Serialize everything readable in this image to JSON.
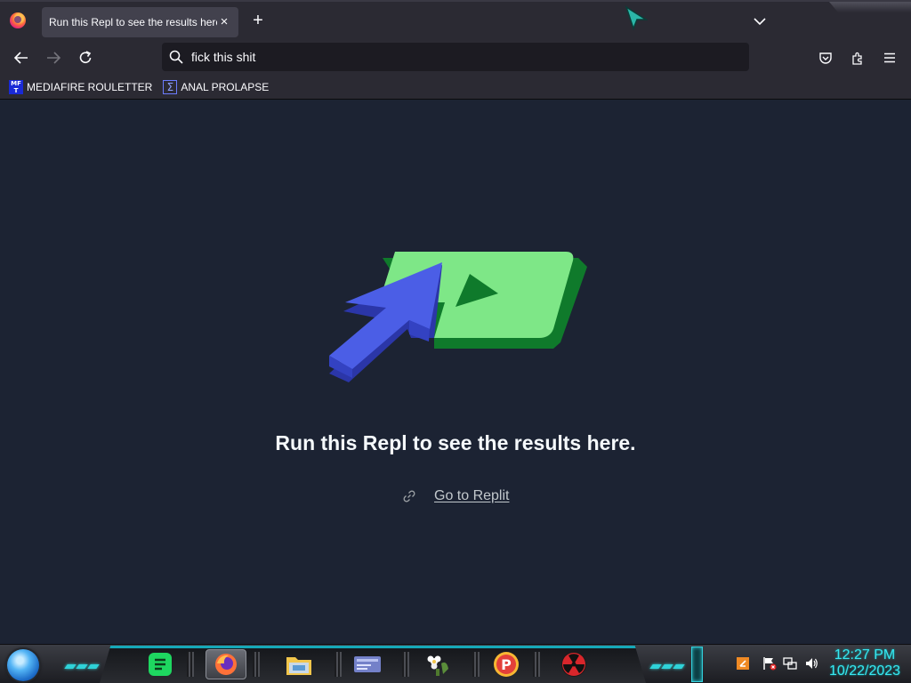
{
  "browser": {
    "tab": {
      "title": "Run this Repl to see the results here.",
      "close_glyph": "×"
    },
    "new_tab_glyph": "+",
    "url": {
      "value": "fick this shit"
    },
    "bookmarks": [
      {
        "label": "MEDIAFIRE ROULETTER",
        "favicon_text": "MF\nT",
        "icon": "mediafire-icon"
      },
      {
        "label": "ANAL PROLAPSE",
        "favicon_text": "Σ",
        "icon": "sigma-icon"
      }
    ]
  },
  "page": {
    "headline": "Run this Repl to see the results here.",
    "link_label": "Go to Replit",
    "colors": {
      "background": "#1c2333",
      "play_green": "#7ee787",
      "play_dark": "#0f7a2b",
      "cursor_blue": "#4b5ee6"
    }
  },
  "taskbar": {
    "clock_time": "12:27 PM",
    "clock_date": "10/22/2023",
    "apps": [
      "spotify-icon",
      "firefox-icon",
      "file-explorer-icon",
      "id-card-icon",
      "flower-app-icon",
      "p-app-icon",
      "radiation-app-icon"
    ],
    "accent": "#2fd2d8"
  }
}
